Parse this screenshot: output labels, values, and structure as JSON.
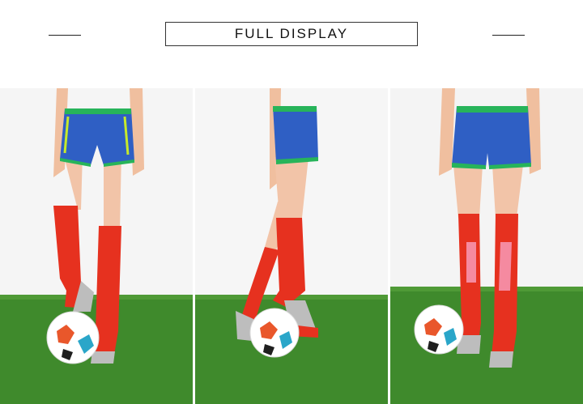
{
  "header": {
    "title": "FULL DISPLAY"
  },
  "photos": [
    {
      "view": "front",
      "icon": "soccer-ball-icon"
    },
    {
      "view": "side",
      "icon": "soccer-ball-icon"
    },
    {
      "view": "back",
      "icon": "soccer-ball-icon"
    }
  ],
  "colors": {
    "sock_red": "#e6311f",
    "shorts_blue": "#2f5fc4",
    "shorts_trim": "#27b45a",
    "grass": "#3f8a2c",
    "sole_grey": "#bdbdbd"
  }
}
